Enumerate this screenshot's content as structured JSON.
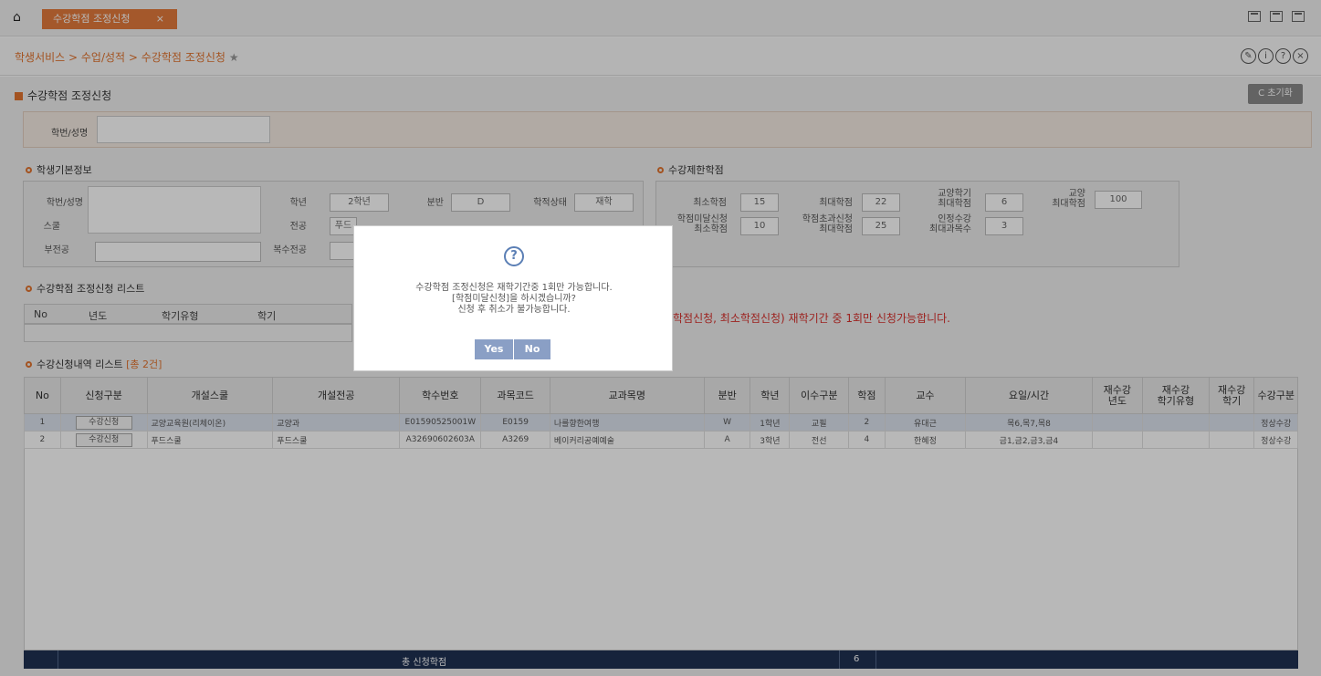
{
  "topbar": {
    "tab_label": "수강학점 조정신청",
    "tab_close": "×"
  },
  "breadcrumb": {
    "path": "학생서비스 > 수업/성적 > 수강학점 조정신청"
  },
  "page": {
    "title": "수강학점 조정신청",
    "reset_label": "C 초기화",
    "id_label": "학번/성명"
  },
  "basic": {
    "title": "학생기본정보",
    "labels": {
      "id_name": "학번/성명",
      "school": "스쿨",
      "minor": "부전공",
      "grade": "학년",
      "major": "전공",
      "double_major": "복수전공",
      "class": "분반",
      "status": "학적상태"
    },
    "values": {
      "grade": "2학년",
      "class": "D",
      "status": "재학",
      "major": "푸드"
    }
  },
  "limits": {
    "title": "수강제한학점",
    "labels": {
      "min": "최소학점",
      "max": "최대학점",
      "liberal_max": "교양학기\n최대학점",
      "liberal_max2": "교양\n최대학점",
      "under_min": "학점미달신청\n최소학점",
      "over_max": "학점초과신청\n최대학점",
      "retake_max": "인정수강\n최대과목수"
    },
    "values": {
      "min": "15",
      "max": "22",
      "liberal_max": "6",
      "liberal_max2": "100",
      "under_min": "10",
      "over_max": "25",
      "retake_max": "3"
    }
  },
  "adjust_list": {
    "title": "수강학점 조정신청 리스트",
    "headers": [
      "No",
      "년도",
      "학기유형",
      "학기"
    ],
    "warning": "학점신청, 최소학점신청) 재학기간 중 1회만 신청가능합니다."
  },
  "enroll_list": {
    "title": "수강신청내역 리스트",
    "count": "[총 2건]",
    "headers": [
      "No",
      "신청구분",
      "개설스쿨",
      "개설전공",
      "학수번호",
      "과목코드",
      "교과목명",
      "분반",
      "학년",
      "이수구분",
      "학점",
      "교수",
      "요일/시간",
      "재수강\n년도",
      "재수강\n학기유형",
      "재수강\n학기",
      "수강구분"
    ],
    "rows": [
      [
        "1",
        "수강신청",
        "교양교육원(리체이온)",
        "교양과",
        "E01590525001W",
        "E0159",
        "나를향한여행",
        "W",
        "1학년",
        "교필",
        "2",
        "유대근",
        "목6,목7,목8",
        "",
        "",
        "",
        "정상수강"
      ],
      [
        "2",
        "수강신청",
        "푸드스쿨",
        "푸드스쿨",
        "A32690602603A",
        "A3269",
        "베이커리공예예술",
        "A",
        "3학년",
        "전선",
        "4",
        "한혜정",
        "금1,금2,금3,금4",
        "",
        "",
        "",
        "정상수강"
      ]
    ],
    "footer_label": "총 신청학점",
    "footer_total": "6"
  },
  "modal": {
    "icon": "question-icon",
    "line1": "수강학점 조정신청은 재학기간중 1회만 가능합니다.",
    "line2": "[학점미달신청]을 하시겠습니까?",
    "line3": "신청 후 취소가 불가능합니다.",
    "yes": "Yes",
    "no": "No"
  },
  "colors": {
    "accent": "#e2742f",
    "navy": "#1f3152",
    "warning": "#d9302c",
    "modal_button": "#8a9fc5"
  }
}
